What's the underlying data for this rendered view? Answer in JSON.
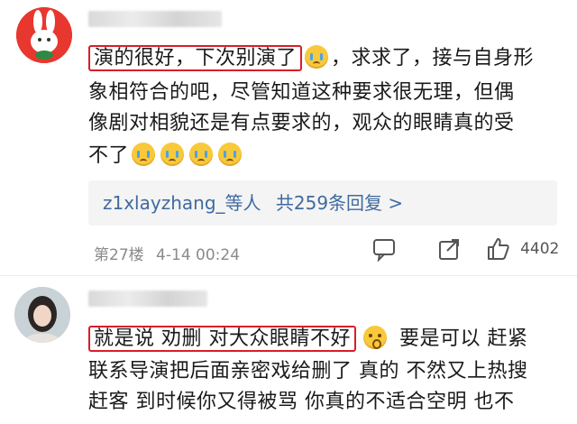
{
  "comment1": {
    "highlighted": "演的很好，下次别演了",
    "after_emoji": "，求求了，接与自身形",
    "line2": "象相符合的吧，尽管知道这种要求很无理，但偶",
    "line3": "像剧对相貌还是有点要求的，观众的眼睛真的受",
    "line4_text": "不了",
    "replies_users": "z1xlayzhang_等人",
    "replies_count": "共259条回复 >",
    "floor": "第27楼",
    "date": "4-14 00:24",
    "like_count": "4402"
  },
  "comment2": {
    "highlighted": "就是说 劝删 对大众眼睛不好",
    "after_emoji": "要是可以 赶紧",
    "line2": "联系导演把后面亲密戏给删了 真的 不然又上热搜",
    "line3": "赶客 到时候你又得被骂 你真的不适合空明 也不"
  },
  "icons": [
    "crying-emoji",
    "comment-icon",
    "share-icon",
    "like-icon",
    "surprised-emoji"
  ],
  "colors": {
    "highlight_border": "#d81e28",
    "link": "#3f6aa0",
    "meta": "#8a8a8a"
  }
}
